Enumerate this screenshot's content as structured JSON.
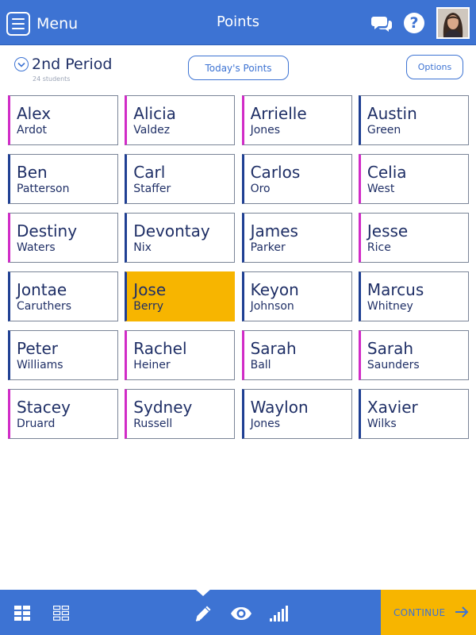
{
  "header": {
    "menu_label": "Menu",
    "title": "Points",
    "chat_icon": "chat-bubbles-icon",
    "help_glyph": "?",
    "avatar": "teacher-avatar"
  },
  "class_bar": {
    "period_name": "2nd Period",
    "student_count": "24 students",
    "todays_points_label": "Today's Points",
    "options_label": "Options"
  },
  "students": [
    {
      "first": "Alex",
      "last": "Ardot",
      "accent": "magenta",
      "selected": false
    },
    {
      "first": "Alicia",
      "last": "Valdez",
      "accent": "magenta",
      "selected": false
    },
    {
      "first": "Arrielle",
      "last": "Jones",
      "accent": "magenta",
      "selected": false
    },
    {
      "first": "Austin",
      "last": "Green",
      "accent": "blue",
      "selected": false
    },
    {
      "first": "Ben",
      "last": "Patterson",
      "accent": "blue",
      "selected": false
    },
    {
      "first": "Carl",
      "last": "Staffer",
      "accent": "blue",
      "selected": false
    },
    {
      "first": "Carlos",
      "last": "Oro",
      "accent": "blue",
      "selected": false
    },
    {
      "first": "Celia",
      "last": "West",
      "accent": "magenta",
      "selected": false
    },
    {
      "first": "Destiny",
      "last": "Waters",
      "accent": "magenta",
      "selected": false
    },
    {
      "first": "Devontay",
      "last": "Nix",
      "accent": "blue",
      "selected": false
    },
    {
      "first": "James",
      "last": "Parker",
      "accent": "blue",
      "selected": false
    },
    {
      "first": "Jesse",
      "last": "Rice",
      "accent": "magenta",
      "selected": false
    },
    {
      "first": "Jontae",
      "last": "Caruthers",
      "accent": "blue",
      "selected": false
    },
    {
      "first": "Jose",
      "last": "Berry",
      "accent": "blue",
      "selected": true
    },
    {
      "first": "Keyon",
      "last": "Johnson",
      "accent": "blue",
      "selected": false
    },
    {
      "first": "Marcus",
      "last": "Whitney",
      "accent": "blue",
      "selected": false
    },
    {
      "first": "Peter",
      "last": "Williams",
      "accent": "blue",
      "selected": false
    },
    {
      "first": "Rachel",
      "last": "Heiner",
      "accent": "magenta",
      "selected": false
    },
    {
      "first": "Sarah",
      "last": "Ball",
      "accent": "magenta",
      "selected": false
    },
    {
      "first": "Sarah",
      "last": "Saunders",
      "accent": "magenta",
      "selected": false
    },
    {
      "first": "Stacey",
      "last": "Druard",
      "accent": "magenta",
      "selected": false
    },
    {
      "first": "Sydney",
      "last": "Russell",
      "accent": "magenta",
      "selected": false
    },
    {
      "first": "Waylon",
      "last": "Jones",
      "accent": "blue",
      "selected": false
    },
    {
      "first": "Xavier",
      "last": "Wilks",
      "accent": "blue",
      "selected": false
    }
  ],
  "footer": {
    "grid_view_icon": "grid-large-icon",
    "list_view_icon": "grid-small-icon",
    "edit_icon": "pencil-icon",
    "view_icon": "eye-icon",
    "stats_icon": "signal-bars-icon",
    "continue_label": "CONTINUE"
  },
  "colors": {
    "primary": "#3d73d3",
    "accent": "#f7b500",
    "text": "#1f2f66",
    "blue_accent": "#1f3f93",
    "magenta_accent": "#d12bc7"
  }
}
